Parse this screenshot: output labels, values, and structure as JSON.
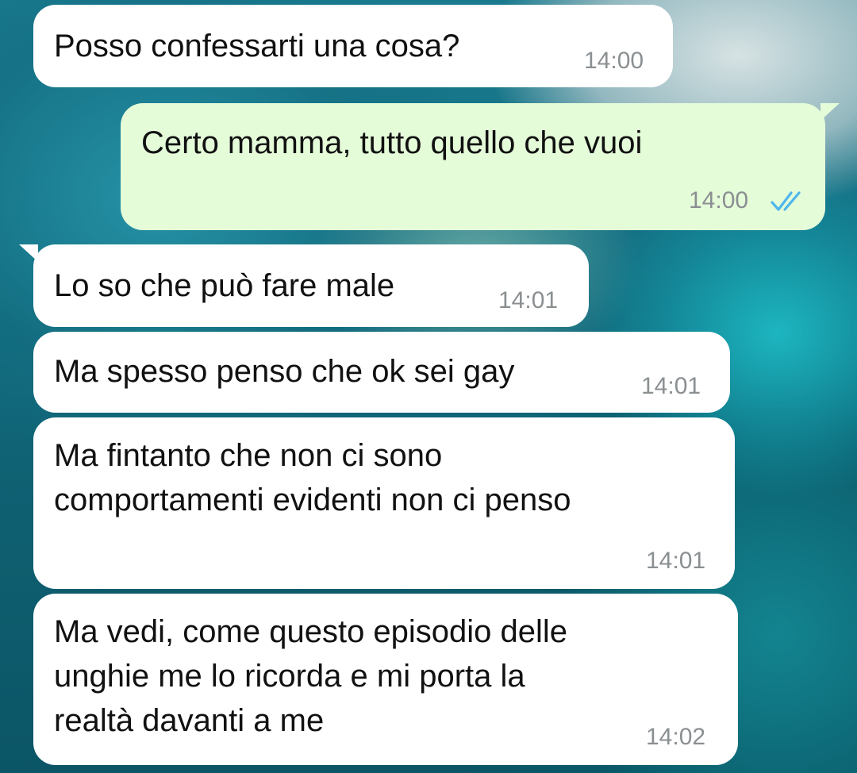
{
  "chat": {
    "messages": [
      {
        "direction": "in",
        "text": "Posso confessarti una cosa?",
        "time": "14:00"
      },
      {
        "direction": "out",
        "text": "Certo mamma, tutto quello che vuoi",
        "time": "14:00",
        "status_icon": "read-double-check-icon",
        "status_color": "#4fb6ec"
      },
      {
        "direction": "in",
        "text": "Lo so che può fare male",
        "time": "14:01"
      },
      {
        "direction": "in",
        "text": "Ma spesso penso che ok sei gay",
        "time": "14:01"
      },
      {
        "direction": "in",
        "lines": [
          "Ma fintanto che non ci sono",
          "comportamenti evidenti non ci penso"
        ],
        "time": "14:01"
      },
      {
        "direction": "in",
        "lines": [
          "Ma vedi, come questo episodio delle",
          "unghie me lo ricorda e mi porta la",
          "realtà davanti a me"
        ],
        "time": "14:02"
      }
    ]
  },
  "colors": {
    "incoming_bubble": "#ffffff",
    "outgoing_bubble": "#e5fcd9",
    "timestamp": "#8a8f92",
    "read_ticks": "#4fb6ec"
  }
}
